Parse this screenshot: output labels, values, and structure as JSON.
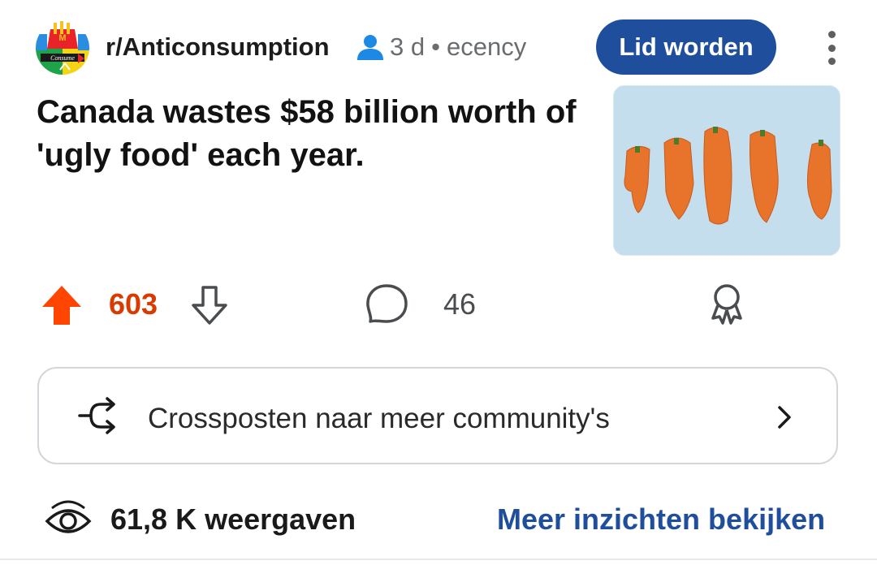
{
  "post": {
    "community": "r/Anticonsumption",
    "age": "3 d",
    "separator": "•",
    "author": "ecency",
    "join_label": "Lid worden",
    "avatar_text": "Consume",
    "title": "Canada wastes $58 billion worth of 'ugly food' each year.",
    "thumbnail_alt": "ugly carrots"
  },
  "actions": {
    "score": "603",
    "comments": "46"
  },
  "crosspost": {
    "label": "Crossposten naar meer community's"
  },
  "footer": {
    "views": "61,8 K weergaven",
    "insights_label": "Meer inzichten bekijken"
  },
  "icons": [
    "avatar",
    "person-icon",
    "more-vert-icon",
    "upvote-icon",
    "downvote-icon",
    "comment-icon",
    "award-icon",
    "crosspost-icon",
    "chevron-right-icon",
    "eye-icon"
  ],
  "colors": {
    "accent_blue": "#1f4f9c",
    "upvote_orange": "#ff4500",
    "score_orange": "#d93a00",
    "muted_gray": "#6a6d70"
  }
}
